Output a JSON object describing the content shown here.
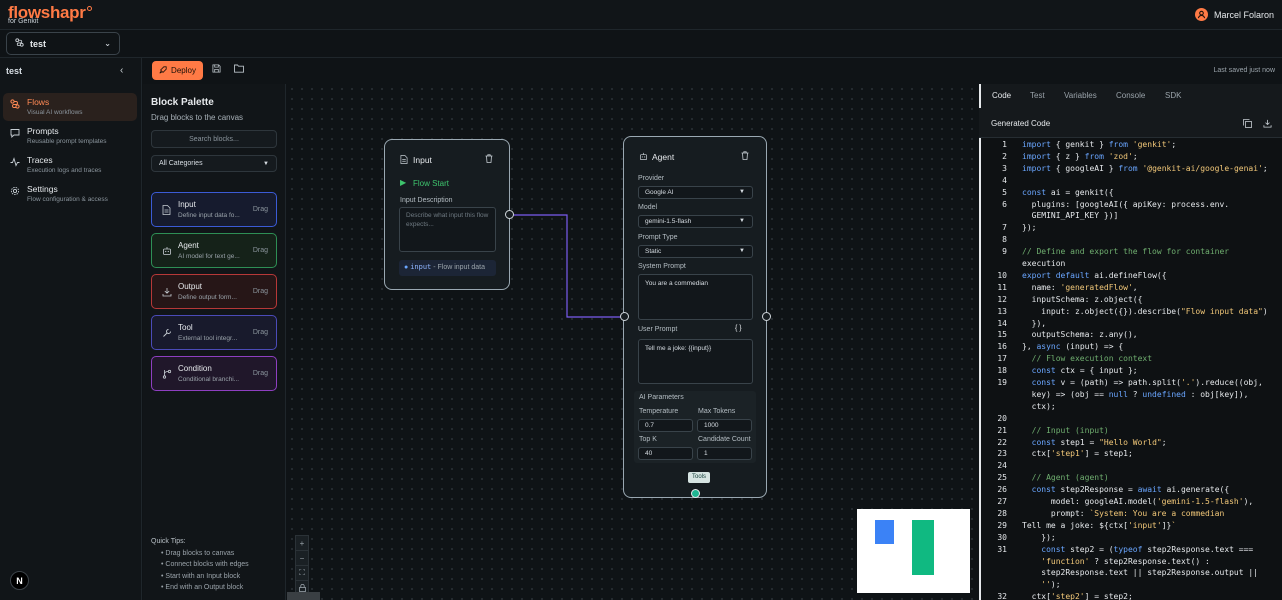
{
  "app": {
    "logo": "flowshapr",
    "logo_sub": "for Genkit",
    "user_name": "Marcel Folaron",
    "avatar_letter": "N"
  },
  "flow_select": {
    "value": "test"
  },
  "sidebar": {
    "title": "test",
    "items": [
      {
        "label": "Flows",
        "sub": "Visual AI workflows",
        "icon": "flow-icon"
      },
      {
        "label": "Prompts",
        "sub": "Reusable prompt templates",
        "icon": "chat-icon"
      },
      {
        "label": "Traces",
        "sub": "Execution logs and traces",
        "icon": "activity-icon"
      },
      {
        "label": "Settings",
        "sub": "Flow configuration & access",
        "icon": "gear-icon"
      }
    ]
  },
  "toolbar": {
    "deploy_label": "Deploy",
    "last_saved": "Last saved just now"
  },
  "palette": {
    "title": "Block Palette",
    "subtitle": "Drag blocks to the canvas",
    "search_placeholder": "Search blocks...",
    "category": "All Categories",
    "blocks": [
      {
        "label": "Input",
        "sub": "Define input data fo...",
        "drag": "Drag",
        "color": "#3b5bd6"
      },
      {
        "label": "Agent",
        "sub": "AI model for text ge...",
        "drag": "Drag",
        "color": "#2e8f55"
      },
      {
        "label": "Output",
        "sub": "Define output form...",
        "drag": "Drag",
        "color": "#b63838"
      },
      {
        "label": "Tool",
        "sub": "External tool integr...",
        "drag": "Drag",
        "color": "#4b4bb8"
      },
      {
        "label": "Condition",
        "sub": "Conditional branchi...",
        "drag": "Drag",
        "color": "#8e3fc0"
      }
    ],
    "tips_title": "Quick Tips:",
    "tips": [
      "Drag blocks to canvas",
      "Connect blocks with edges",
      "Start with an Input block",
      "End with an Output block"
    ]
  },
  "canvas": {
    "input_node": {
      "title": "Input",
      "flow_start": "Flow Start",
      "desc_label": "Input Description",
      "desc_placeholder": "Describe what input this flow expects...",
      "var_name": "input",
      "var_desc": "- Flow input data"
    },
    "agent_node": {
      "title": "Agent",
      "provider_label": "Provider",
      "provider_value": "Google AI",
      "model_label": "Model",
      "model_value": "gemini-1.5-flash",
      "prompt_type_label": "Prompt Type",
      "prompt_type_value": "Static",
      "system_prompt_label": "System Prompt",
      "system_prompt_value": "You are a commedian",
      "user_prompt_label": "User Prompt",
      "user_prompt_braces": "{ }",
      "user_prompt_value": "Tell me a joke: {{input}}",
      "params_label": "AI Parameters",
      "temperature_label": "Temperature",
      "temperature_value": "0.7",
      "max_tokens_label": "Max Tokens",
      "max_tokens_value": "1000",
      "top_k_label": "Top K",
      "top_k_value": "40",
      "candidate_label": "Candidate Count",
      "candidate_value": "1",
      "tools_label": "Tools"
    },
    "zoom": [
      "+",
      "−",
      "⛶",
      "🔒"
    ]
  },
  "code_panel": {
    "tabs": [
      "Code",
      "Test",
      "Variables",
      "Console",
      "SDK"
    ],
    "active_tab": "Code",
    "title": "Generated Code",
    "lines": [
      {
        "n": "1",
        "t": "import { genkit } from 'genkit';"
      },
      {
        "n": "2",
        "t": "import { z } from 'zod';"
      },
      {
        "n": "3",
        "t": "import { googleAI } from '@genkit-ai/google-genai';"
      },
      {
        "n": "4",
        "t": ""
      },
      {
        "n": "5",
        "t": "const ai = genkit({"
      },
      {
        "n": "6",
        "t": "  plugins: [googleAI({ apiKey: process.env."
      },
      {
        "n": "",
        "t": "  GEMINI_API_KEY })]"
      },
      {
        "n": "7",
        "t": "});"
      },
      {
        "n": "8",
        "t": ""
      },
      {
        "n": "9",
        "t": "// Define and export the flow for container"
      },
      {
        "n": "",
        "t": "execution"
      },
      {
        "n": "10",
        "t": "export default ai.defineFlow({"
      },
      {
        "n": "11",
        "t": "  name: 'generatedFlow',"
      },
      {
        "n": "12",
        "t": "  inputSchema: z.object({"
      },
      {
        "n": "13",
        "t": "    input: z.object({}).describe(\"Flow input data\")"
      },
      {
        "n": "14",
        "t": "  }),"
      },
      {
        "n": "15",
        "t": "  outputSchema: z.any(),"
      },
      {
        "n": "16",
        "t": "}, async (input) => {"
      },
      {
        "n": "17",
        "t": "  // Flow execution context"
      },
      {
        "n": "18",
        "t": "  const ctx = { input };"
      },
      {
        "n": "19",
        "t": "  const v = (path) => path.split('.').reduce((obj,"
      },
      {
        "n": "",
        "t": "  key) => (obj == null ? undefined : obj[key]),"
      },
      {
        "n": "",
        "t": "  ctx);"
      },
      {
        "n": "20",
        "t": ""
      },
      {
        "n": "21",
        "t": "  // Input (input)"
      },
      {
        "n": "22",
        "t": "  const step1 = \"Hello World\";"
      },
      {
        "n": "23",
        "t": "  ctx['step1'] = step1;"
      },
      {
        "n": "24",
        "t": ""
      },
      {
        "n": "25",
        "t": "  // Agent (agent)"
      },
      {
        "n": "26",
        "t": "  const step2Response = await ai.generate({"
      },
      {
        "n": "27",
        "t": "      model: googleAI.model('gemini-1.5-flash'),"
      },
      {
        "n": "28",
        "t": "      prompt: `System: You are a commedian"
      },
      {
        "n": "29",
        "t": "Tell me a joke: ${ctx['input']}`"
      },
      {
        "n": "30",
        "t": "    });"
      },
      {
        "n": "31",
        "t": "    const step2 = (typeof step2Response.text ==="
      },
      {
        "n": "",
        "t": "    'function' ? step2Response.text() :"
      },
      {
        "n": "",
        "t": "    step2Response.text || step2Response.output ||"
      },
      {
        "n": "",
        "t": "    '');"
      },
      {
        "n": "32",
        "t": "  ctx['step2'] = step2;"
      }
    ]
  }
}
